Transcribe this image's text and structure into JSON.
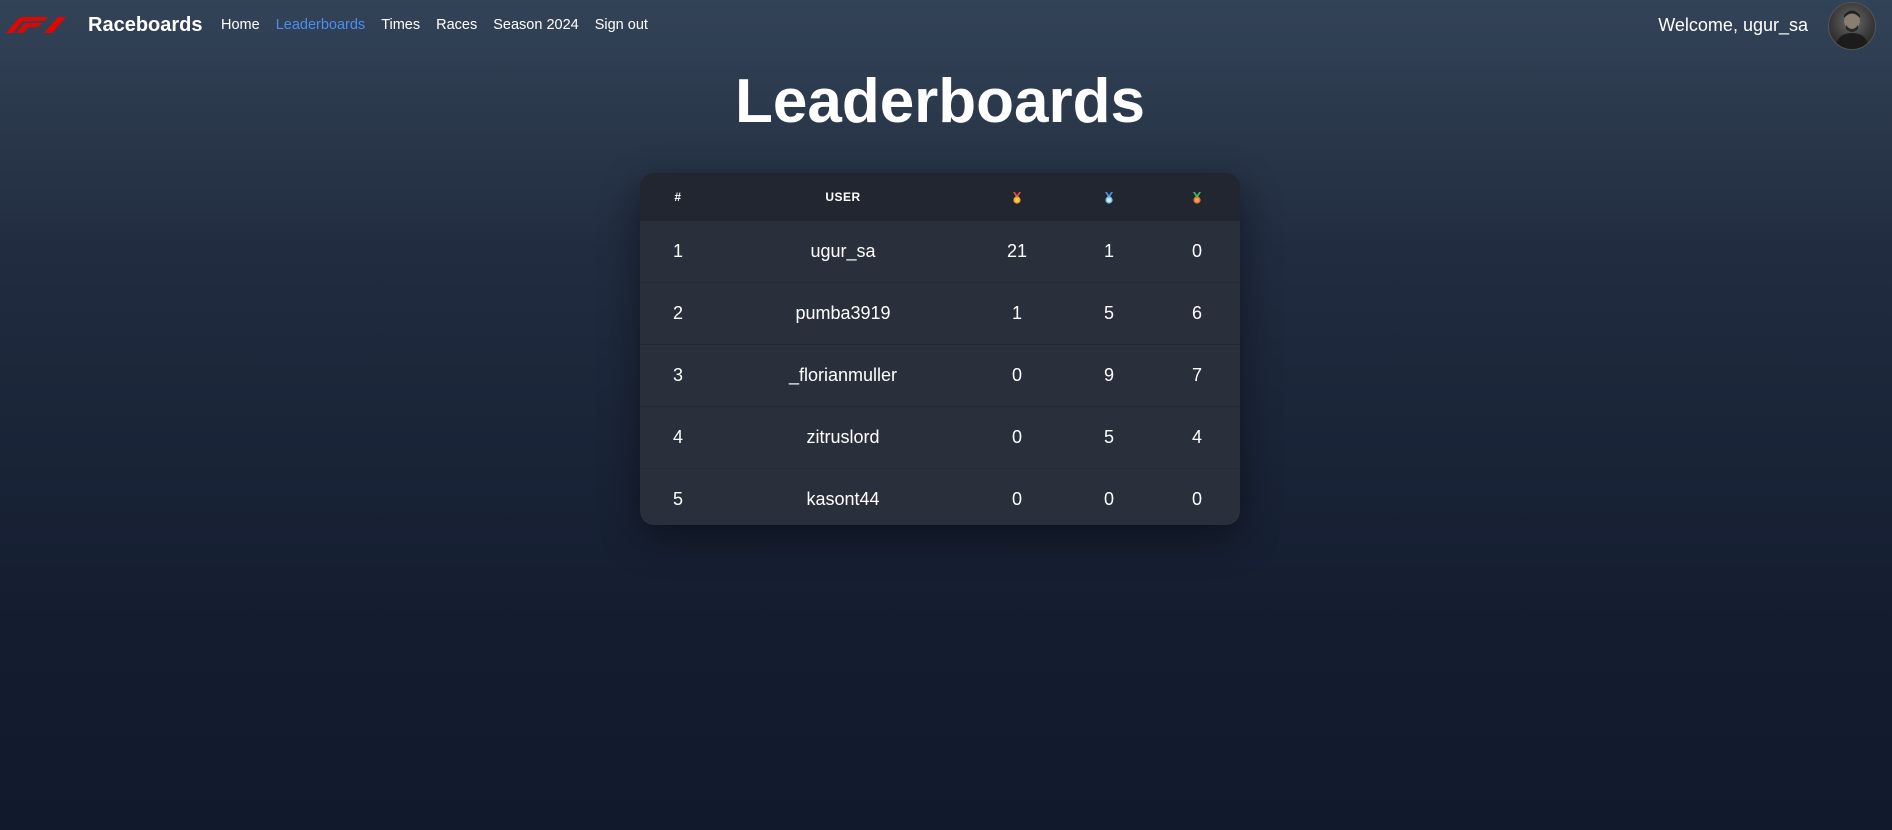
{
  "navbar": {
    "brand": "Raceboards",
    "links": [
      {
        "label": "Home",
        "active": false
      },
      {
        "label": "Leaderboards",
        "active": true
      },
      {
        "label": "Times",
        "active": false
      },
      {
        "label": "Races",
        "active": false
      },
      {
        "label": "Season 2024",
        "active": false
      },
      {
        "label": "Sign out",
        "active": false
      }
    ],
    "welcome": "Welcome, ugur_sa",
    "logo_icon": "f1-logo-icon",
    "avatar_icon": "user-avatar"
  },
  "page": {
    "title": "Leaderboards"
  },
  "leaderboard": {
    "headers": {
      "rank": "#",
      "user": "USER",
      "gold_icon": "gold-medal-icon",
      "silver_icon": "silver-medal-icon",
      "bronze_icon": "bronze-medal-icon"
    },
    "rows": [
      {
        "rank": "1",
        "user": "ugur_sa",
        "gold": "21",
        "silver": "1",
        "bronze": "0"
      },
      {
        "rank": "2",
        "user": "pumba3919",
        "gold": "1",
        "silver": "5",
        "bronze": "6"
      },
      {
        "rank": "3",
        "user": "_florianmuller",
        "gold": "0",
        "silver": "9",
        "bronze": "7"
      },
      {
        "rank": "4",
        "user": "zitruslord",
        "gold": "0",
        "silver": "5",
        "bronze": "4"
      },
      {
        "rank": "5",
        "user": "kasont44",
        "gold": "0",
        "silver": "0",
        "bronze": "0"
      }
    ]
  },
  "colors": {
    "accent_link": "#4a8ff0",
    "f1_red": "#e10600",
    "gold": "#f5a623",
    "silver": "#7fc4e8",
    "bronze": "#e07a2e"
  }
}
